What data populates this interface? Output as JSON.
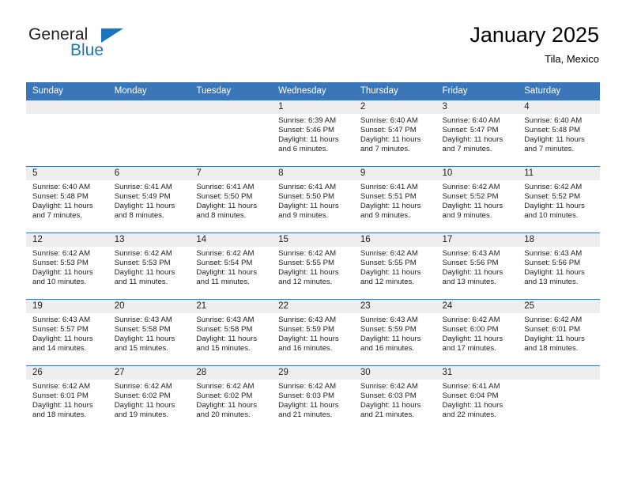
{
  "brand": {
    "name_part1": "General",
    "name_part2": "Blue",
    "triangle_color": "#1e74bb",
    "text_color": "#231f20"
  },
  "header": {
    "title": "January 2025",
    "subtitle": "Tila, Mexico"
  },
  "colors": {
    "header_row_bg": "#3a76b8",
    "header_row_text": "#ffffff",
    "daynum_band_bg": "#eeeeee",
    "cell_bg": "#ffffff",
    "row_divider": "#3a76b8",
    "body_text": "#231f20"
  },
  "weekday_headers": [
    "Sunday",
    "Monday",
    "Tuesday",
    "Wednesday",
    "Thursday",
    "Friday",
    "Saturday"
  ],
  "labels": {
    "sunrise_prefix": "Sunrise: ",
    "sunset_prefix": "Sunset: ",
    "daylight_prefix": "Daylight: "
  },
  "weeks": [
    [
      {
        "day": "",
        "sunrise": "",
        "sunset": "",
        "daylight_line1": "",
        "daylight_line2": "",
        "empty": true
      },
      {
        "day": "",
        "sunrise": "",
        "sunset": "",
        "daylight_line1": "",
        "daylight_line2": "",
        "empty": true
      },
      {
        "day": "",
        "sunrise": "",
        "sunset": "",
        "daylight_line1": "",
        "daylight_line2": "",
        "empty": true
      },
      {
        "day": "1",
        "sunrise": "Sunrise: 6:39 AM",
        "sunset": "Sunset: 5:46 PM",
        "daylight_line1": "Daylight: 11 hours",
        "daylight_line2": "and 6 minutes.",
        "empty": false
      },
      {
        "day": "2",
        "sunrise": "Sunrise: 6:40 AM",
        "sunset": "Sunset: 5:47 PM",
        "daylight_line1": "Daylight: 11 hours",
        "daylight_line2": "and 7 minutes.",
        "empty": false
      },
      {
        "day": "3",
        "sunrise": "Sunrise: 6:40 AM",
        "sunset": "Sunset: 5:47 PM",
        "daylight_line1": "Daylight: 11 hours",
        "daylight_line2": "and 7 minutes.",
        "empty": false
      },
      {
        "day": "4",
        "sunrise": "Sunrise: 6:40 AM",
        "sunset": "Sunset: 5:48 PM",
        "daylight_line1": "Daylight: 11 hours",
        "daylight_line2": "and 7 minutes.",
        "empty": false
      }
    ],
    [
      {
        "day": "5",
        "sunrise": "Sunrise: 6:40 AM",
        "sunset": "Sunset: 5:48 PM",
        "daylight_line1": "Daylight: 11 hours",
        "daylight_line2": "and 7 minutes.",
        "empty": false
      },
      {
        "day": "6",
        "sunrise": "Sunrise: 6:41 AM",
        "sunset": "Sunset: 5:49 PM",
        "daylight_line1": "Daylight: 11 hours",
        "daylight_line2": "and 8 minutes.",
        "empty": false
      },
      {
        "day": "7",
        "sunrise": "Sunrise: 6:41 AM",
        "sunset": "Sunset: 5:50 PM",
        "daylight_line1": "Daylight: 11 hours",
        "daylight_line2": "and 8 minutes.",
        "empty": false
      },
      {
        "day": "8",
        "sunrise": "Sunrise: 6:41 AM",
        "sunset": "Sunset: 5:50 PM",
        "daylight_line1": "Daylight: 11 hours",
        "daylight_line2": "and 9 minutes.",
        "empty": false
      },
      {
        "day": "9",
        "sunrise": "Sunrise: 6:41 AM",
        "sunset": "Sunset: 5:51 PM",
        "daylight_line1": "Daylight: 11 hours",
        "daylight_line2": "and 9 minutes.",
        "empty": false
      },
      {
        "day": "10",
        "sunrise": "Sunrise: 6:42 AM",
        "sunset": "Sunset: 5:52 PM",
        "daylight_line1": "Daylight: 11 hours",
        "daylight_line2": "and 9 minutes.",
        "empty": false
      },
      {
        "day": "11",
        "sunrise": "Sunrise: 6:42 AM",
        "sunset": "Sunset: 5:52 PM",
        "daylight_line1": "Daylight: 11 hours",
        "daylight_line2": "and 10 minutes.",
        "empty": false
      }
    ],
    [
      {
        "day": "12",
        "sunrise": "Sunrise: 6:42 AM",
        "sunset": "Sunset: 5:53 PM",
        "daylight_line1": "Daylight: 11 hours",
        "daylight_line2": "and 10 minutes.",
        "empty": false
      },
      {
        "day": "13",
        "sunrise": "Sunrise: 6:42 AM",
        "sunset": "Sunset: 5:53 PM",
        "daylight_line1": "Daylight: 11 hours",
        "daylight_line2": "and 11 minutes.",
        "empty": false
      },
      {
        "day": "14",
        "sunrise": "Sunrise: 6:42 AM",
        "sunset": "Sunset: 5:54 PM",
        "daylight_line1": "Daylight: 11 hours",
        "daylight_line2": "and 11 minutes.",
        "empty": false
      },
      {
        "day": "15",
        "sunrise": "Sunrise: 6:42 AM",
        "sunset": "Sunset: 5:55 PM",
        "daylight_line1": "Daylight: 11 hours",
        "daylight_line2": "and 12 minutes.",
        "empty": false
      },
      {
        "day": "16",
        "sunrise": "Sunrise: 6:42 AM",
        "sunset": "Sunset: 5:55 PM",
        "daylight_line1": "Daylight: 11 hours",
        "daylight_line2": "and 12 minutes.",
        "empty": false
      },
      {
        "day": "17",
        "sunrise": "Sunrise: 6:43 AM",
        "sunset": "Sunset: 5:56 PM",
        "daylight_line1": "Daylight: 11 hours",
        "daylight_line2": "and 13 minutes.",
        "empty": false
      },
      {
        "day": "18",
        "sunrise": "Sunrise: 6:43 AM",
        "sunset": "Sunset: 5:56 PM",
        "daylight_line1": "Daylight: 11 hours",
        "daylight_line2": "and 13 minutes.",
        "empty": false
      }
    ],
    [
      {
        "day": "19",
        "sunrise": "Sunrise: 6:43 AM",
        "sunset": "Sunset: 5:57 PM",
        "daylight_line1": "Daylight: 11 hours",
        "daylight_line2": "and 14 minutes.",
        "empty": false
      },
      {
        "day": "20",
        "sunrise": "Sunrise: 6:43 AM",
        "sunset": "Sunset: 5:58 PM",
        "daylight_line1": "Daylight: 11 hours",
        "daylight_line2": "and 15 minutes.",
        "empty": false
      },
      {
        "day": "21",
        "sunrise": "Sunrise: 6:43 AM",
        "sunset": "Sunset: 5:58 PM",
        "daylight_line1": "Daylight: 11 hours",
        "daylight_line2": "and 15 minutes.",
        "empty": false
      },
      {
        "day": "22",
        "sunrise": "Sunrise: 6:43 AM",
        "sunset": "Sunset: 5:59 PM",
        "daylight_line1": "Daylight: 11 hours",
        "daylight_line2": "and 16 minutes.",
        "empty": false
      },
      {
        "day": "23",
        "sunrise": "Sunrise: 6:43 AM",
        "sunset": "Sunset: 5:59 PM",
        "daylight_line1": "Daylight: 11 hours",
        "daylight_line2": "and 16 minutes.",
        "empty": false
      },
      {
        "day": "24",
        "sunrise": "Sunrise: 6:42 AM",
        "sunset": "Sunset: 6:00 PM",
        "daylight_line1": "Daylight: 11 hours",
        "daylight_line2": "and 17 minutes.",
        "empty": false
      },
      {
        "day": "25",
        "sunrise": "Sunrise: 6:42 AM",
        "sunset": "Sunset: 6:01 PM",
        "daylight_line1": "Daylight: 11 hours",
        "daylight_line2": "and 18 minutes.",
        "empty": false
      }
    ],
    [
      {
        "day": "26",
        "sunrise": "Sunrise: 6:42 AM",
        "sunset": "Sunset: 6:01 PM",
        "daylight_line1": "Daylight: 11 hours",
        "daylight_line2": "and 18 minutes.",
        "empty": false
      },
      {
        "day": "27",
        "sunrise": "Sunrise: 6:42 AM",
        "sunset": "Sunset: 6:02 PM",
        "daylight_line1": "Daylight: 11 hours",
        "daylight_line2": "and 19 minutes.",
        "empty": false
      },
      {
        "day": "28",
        "sunrise": "Sunrise: 6:42 AM",
        "sunset": "Sunset: 6:02 PM",
        "daylight_line1": "Daylight: 11 hours",
        "daylight_line2": "and 20 minutes.",
        "empty": false
      },
      {
        "day": "29",
        "sunrise": "Sunrise: 6:42 AM",
        "sunset": "Sunset: 6:03 PM",
        "daylight_line1": "Daylight: 11 hours",
        "daylight_line2": "and 21 minutes.",
        "empty": false
      },
      {
        "day": "30",
        "sunrise": "Sunrise: 6:42 AM",
        "sunset": "Sunset: 6:03 PM",
        "daylight_line1": "Daylight: 11 hours",
        "daylight_line2": "and 21 minutes.",
        "empty": false
      },
      {
        "day": "31",
        "sunrise": "Sunrise: 6:41 AM",
        "sunset": "Sunset: 6:04 PM",
        "daylight_line1": "Daylight: 11 hours",
        "daylight_line2": "and 22 minutes.",
        "empty": false
      },
      {
        "day": "",
        "sunrise": "",
        "sunset": "",
        "daylight_line1": "",
        "daylight_line2": "",
        "empty": true
      }
    ]
  ]
}
